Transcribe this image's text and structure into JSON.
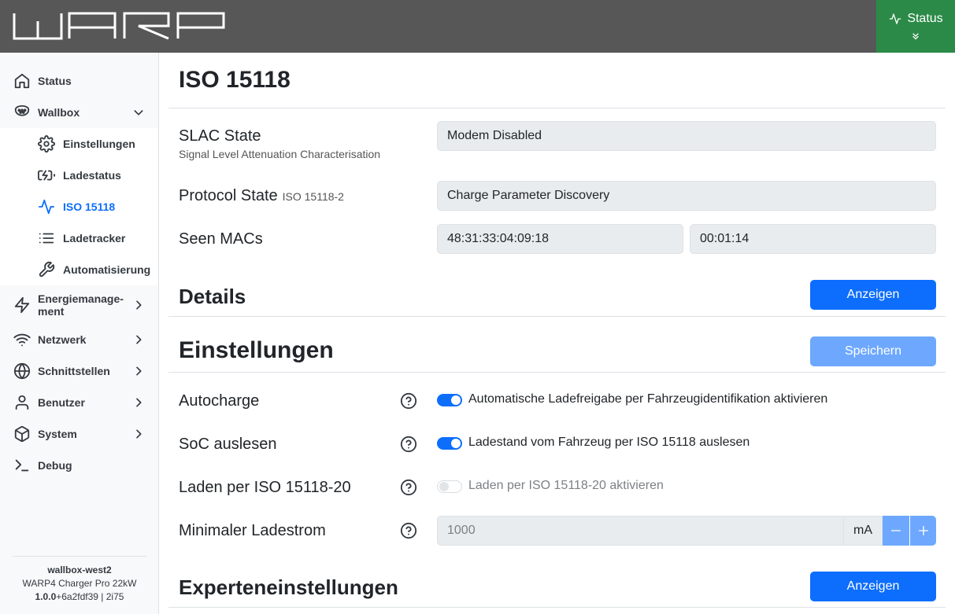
{
  "header": {
    "logo_text": "WARP",
    "status_button_label": "Status"
  },
  "sidebar": {
    "items": [
      {
        "label": "Status",
        "icon": "home-icon"
      },
      {
        "label": "Wallbox",
        "icon": "charger-plug-icon",
        "expanded": true
      },
      {
        "label": "Energiemanage-\nment",
        "icon": "lightning-icon"
      },
      {
        "label": "Netzwerk",
        "icon": "wifi-icon"
      },
      {
        "label": "Schnittstellen",
        "icon": "globe-icon"
      },
      {
        "label": "Benutzer",
        "icon": "user-icon"
      },
      {
        "label": "System",
        "icon": "box-icon"
      },
      {
        "label": "Debug",
        "icon": "terminal-icon"
      }
    ],
    "sub_items": [
      {
        "label": "Einstellungen",
        "icon": "gear-icon"
      },
      {
        "label": "Ladestatus",
        "icon": "battery-charging-icon"
      },
      {
        "label": "ISO 15118",
        "icon": "activity-icon",
        "active": true
      },
      {
        "label": "Ladetracker",
        "icon": "list-icon"
      },
      {
        "label": "Automatisierung",
        "icon": "wrench-icon"
      }
    ],
    "footer": {
      "hostname": "wallbox-west2",
      "device": "WARP4 Charger Pro 22kW",
      "version_bold": "1.0.0",
      "version_rest": "+6a2fdf39 | 2i75"
    }
  },
  "main": {
    "title": "ISO 15118",
    "slac": {
      "label": "SLAC State",
      "sublabel": "Signal Level Attenuation Characterisation",
      "value": "Modem Disabled"
    },
    "protocol": {
      "label": "Protocol State",
      "label_small": "ISO 15118-2",
      "value": "Charge Parameter Discovery"
    },
    "macs": {
      "label": "Seen MACs",
      "mac": "48:31:33:04:09:18",
      "time": "00:01:14"
    },
    "details": {
      "title": "Details",
      "button": "Anzeigen"
    },
    "settings": {
      "title": "Einstellungen",
      "save_button": "Speichern",
      "autocharge": {
        "label": "Autocharge",
        "switch_label": "Automatische Ladefreigabe per Fahrzeugidentifikation aktivieren",
        "checked": true
      },
      "soc": {
        "label": "SoC auslesen",
        "switch_label": "Ladestand vom Fahrzeug per ISO 15118 auslesen",
        "checked": true
      },
      "iso20": {
        "label": "Laden per ISO 15118-20",
        "switch_label": "Laden per ISO 15118-20 aktivieren",
        "checked": false
      },
      "min_current": {
        "label": "Minimaler Ladestrom",
        "placeholder": "1000",
        "unit": "mA"
      }
    },
    "expert": {
      "title": "Experteneinstellungen",
      "button": "Anzeigen"
    }
  },
  "colors": {
    "header_bg": "#575757",
    "status_green": "#2b8a47",
    "accent_blue": "#0d6efd",
    "disabled_blue": "#6ea8fe"
  }
}
